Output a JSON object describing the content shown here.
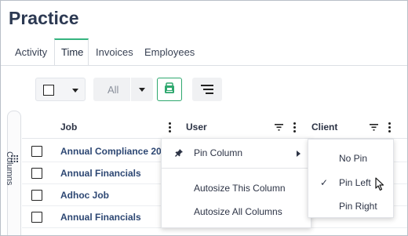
{
  "page": {
    "title": "Practice"
  },
  "tabs": [
    {
      "label": "Activity"
    },
    {
      "label": "Time",
      "active": true
    },
    {
      "label": "Invoices"
    },
    {
      "label": "Employees"
    }
  ],
  "toolbar": {
    "filter_value": "All"
  },
  "side_panel": {
    "label": "Columns"
  },
  "grid": {
    "headers": {
      "job": "Job",
      "user": "User",
      "client": "Client"
    },
    "rows": [
      {
        "job": "Annual Compliance 202"
      },
      {
        "job": "Annual Financials"
      },
      {
        "job": "Adhoc Job"
      },
      {
        "job": "Annual Financials"
      }
    ]
  },
  "column_menu": {
    "pin_column": "Pin Column",
    "autosize_this": "Autosize This Column",
    "autosize_all": "Autosize All Columns"
  },
  "pin_submenu": {
    "no_pin": "No Pin",
    "pin_left": "Pin Left",
    "pin_right": "Pin Right",
    "selected": "Pin Left"
  },
  "colors": {
    "accent": "#35b47f",
    "title": "#2c3952",
    "link": "#2d4773"
  },
  "icons": [
    "checkbox-icon",
    "chevron-down-icon",
    "export-icon",
    "menu-lines-icon",
    "kebab-icon",
    "filter-icon",
    "grid-dots-icon",
    "pin-icon",
    "chevron-right-icon",
    "checkmark-icon",
    "mouse-cursor-icon"
  ]
}
